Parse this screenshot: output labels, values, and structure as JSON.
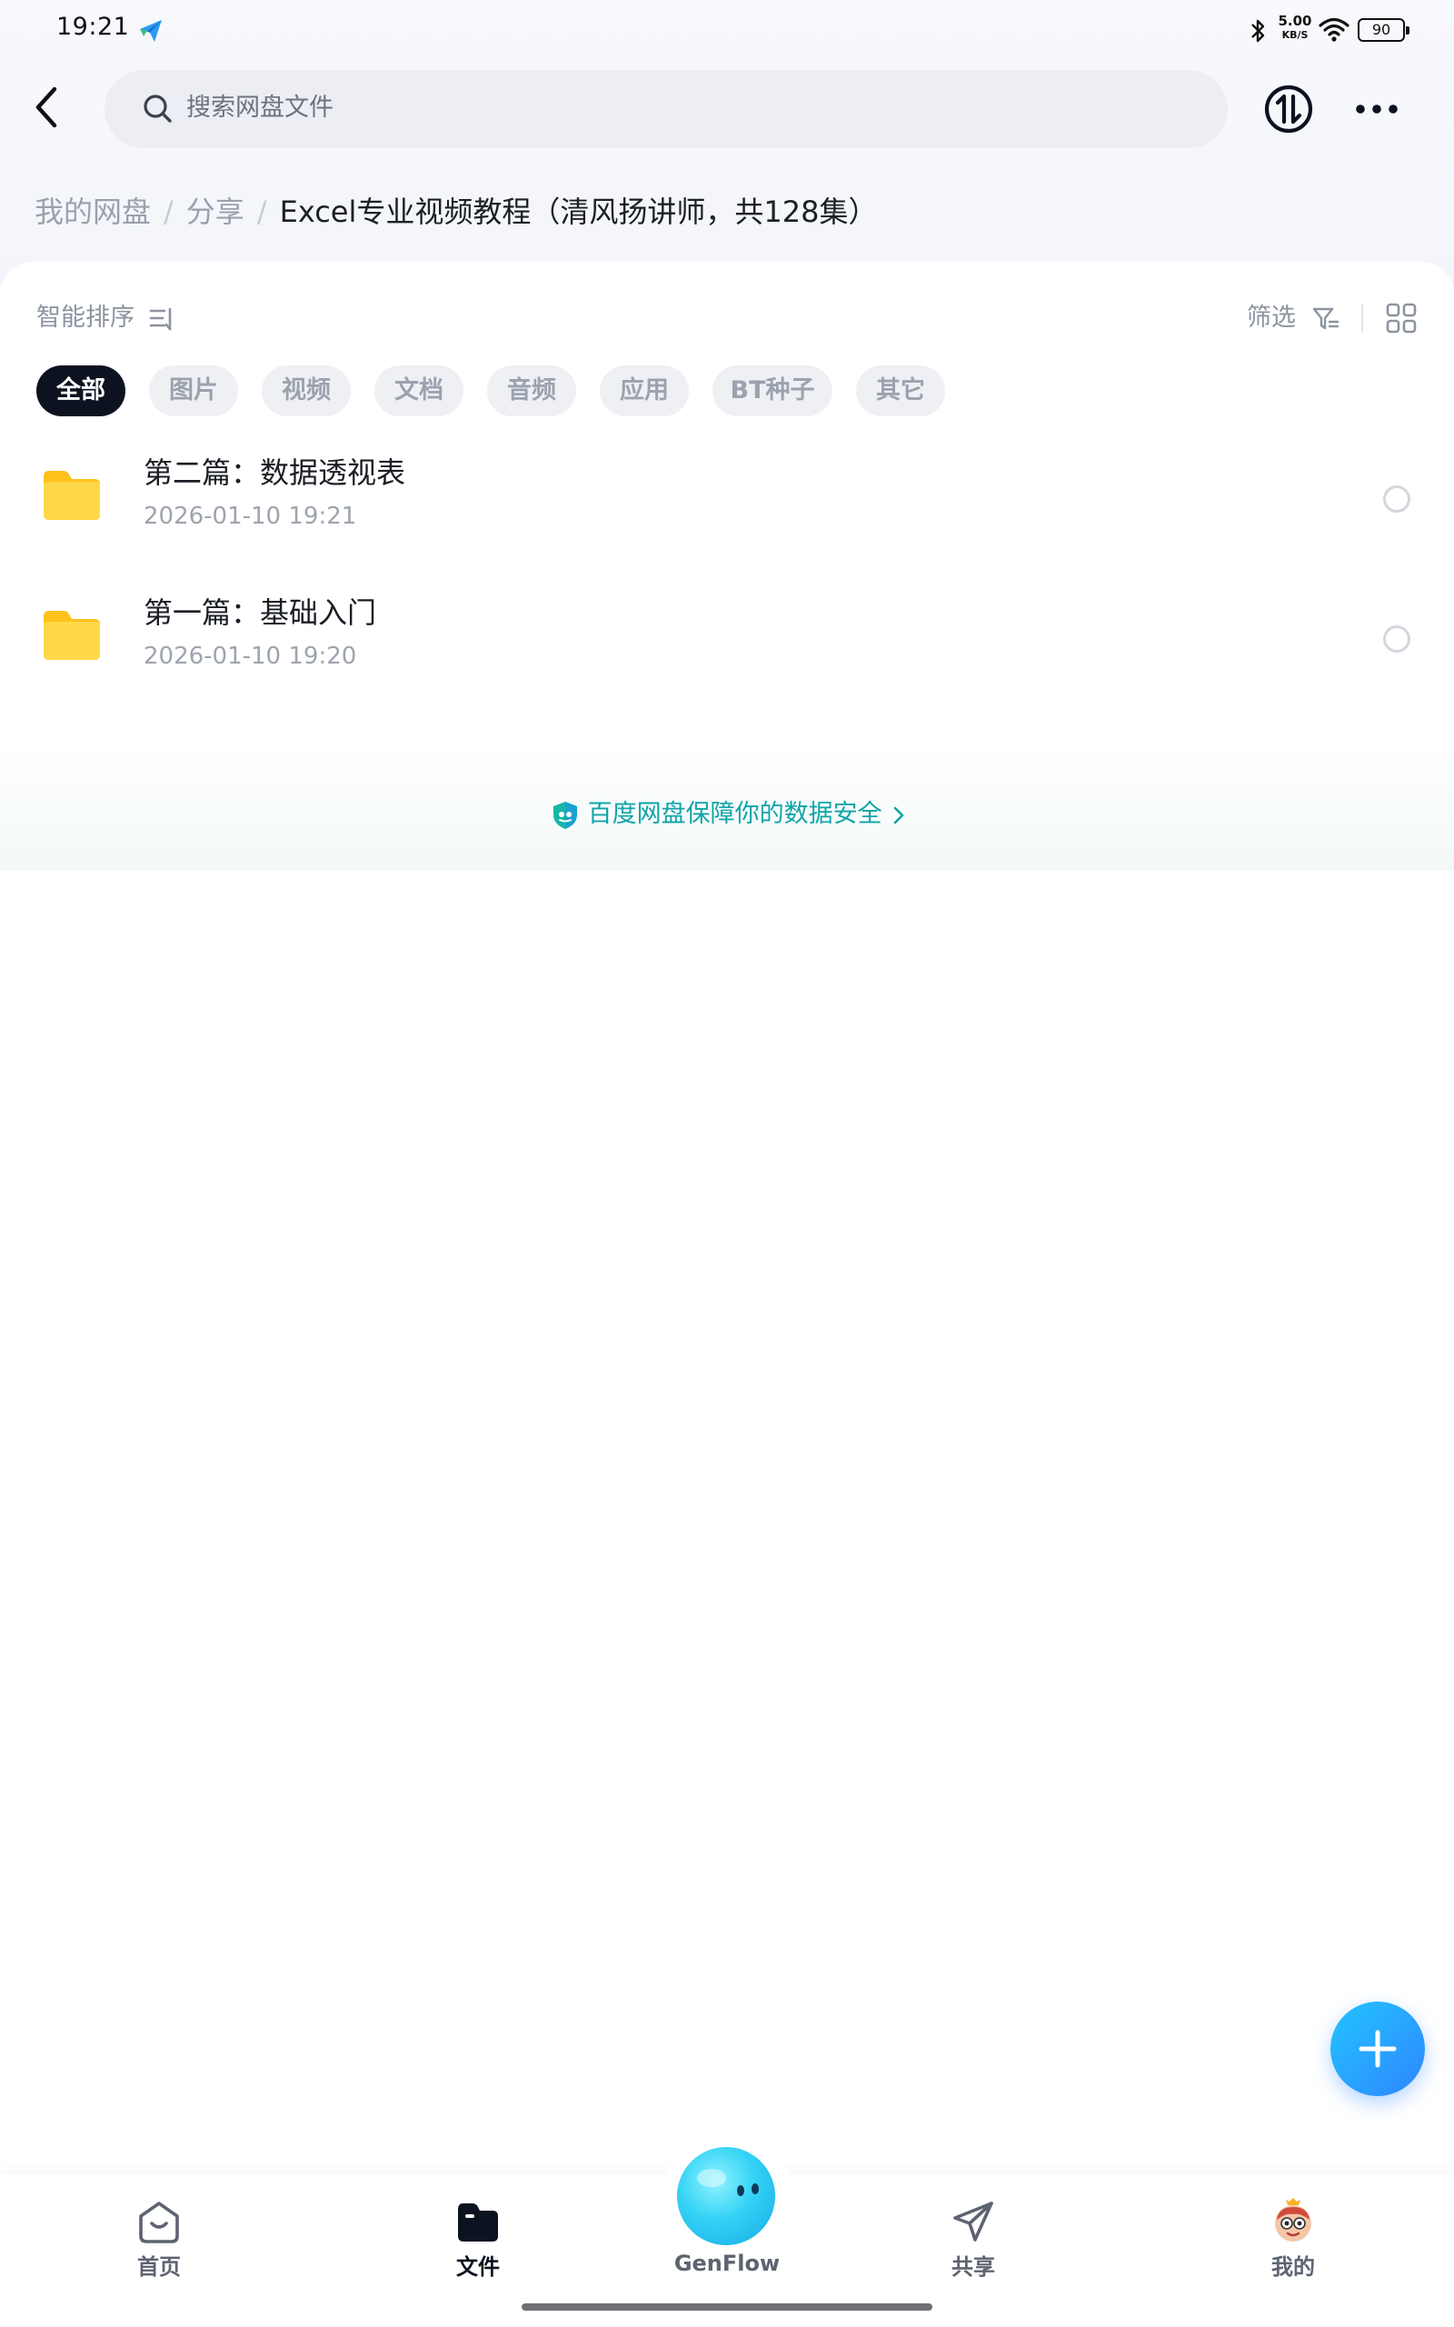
{
  "status_bar": {
    "time": "19:21",
    "net_speed": "5.00",
    "net_speed_unit": "KB/S",
    "battery": "90"
  },
  "header": {
    "search_placeholder": "搜索网盘文件",
    "back_icon": "chevron-left-icon",
    "sync_icon": "transfer-icon",
    "more_icon": "more-dots-icon"
  },
  "breadcrumb": {
    "root": "我的网盘",
    "parent": "分享",
    "current": "Excel专业视频教程（清风扬讲师，共128集）",
    "separator": "/"
  },
  "toolbar": {
    "sort_label": "智能排序",
    "filter_label": "筛选"
  },
  "chips": [
    {
      "label": "全部",
      "active": true
    },
    {
      "label": "图片",
      "active": false
    },
    {
      "label": "视频",
      "active": false
    },
    {
      "label": "文档",
      "active": false
    },
    {
      "label": "音频",
      "active": false
    },
    {
      "label": "应用",
      "active": false
    },
    {
      "label": "BT种子",
      "active": false
    },
    {
      "label": "其它",
      "active": false
    }
  ],
  "files": [
    {
      "name": "第二篇：数据透视表",
      "date": "2026-01-10  19:21",
      "type": "folder"
    },
    {
      "name": "第一篇：基础入门",
      "date": "2026-01-10  19:20",
      "type": "folder"
    }
  ],
  "security": {
    "text": "百度网盘保障你的数据安全"
  },
  "tabs": [
    {
      "label": "首页",
      "icon": "home-icon",
      "active": false
    },
    {
      "label": "文件",
      "icon": "folder-icon",
      "active": true
    },
    {
      "label": "GenFlow",
      "icon": "genflow-orb-icon",
      "active": false
    },
    {
      "label": "共享",
      "icon": "send-icon",
      "active": false
    },
    {
      "label": "我的",
      "icon": "avatar-icon",
      "active": false
    }
  ],
  "colors": {
    "accent": "#2f86ff",
    "security_text": "#0fa4a8",
    "folder_yellow": "#ffcf33",
    "chip_active": "#0c1220"
  }
}
